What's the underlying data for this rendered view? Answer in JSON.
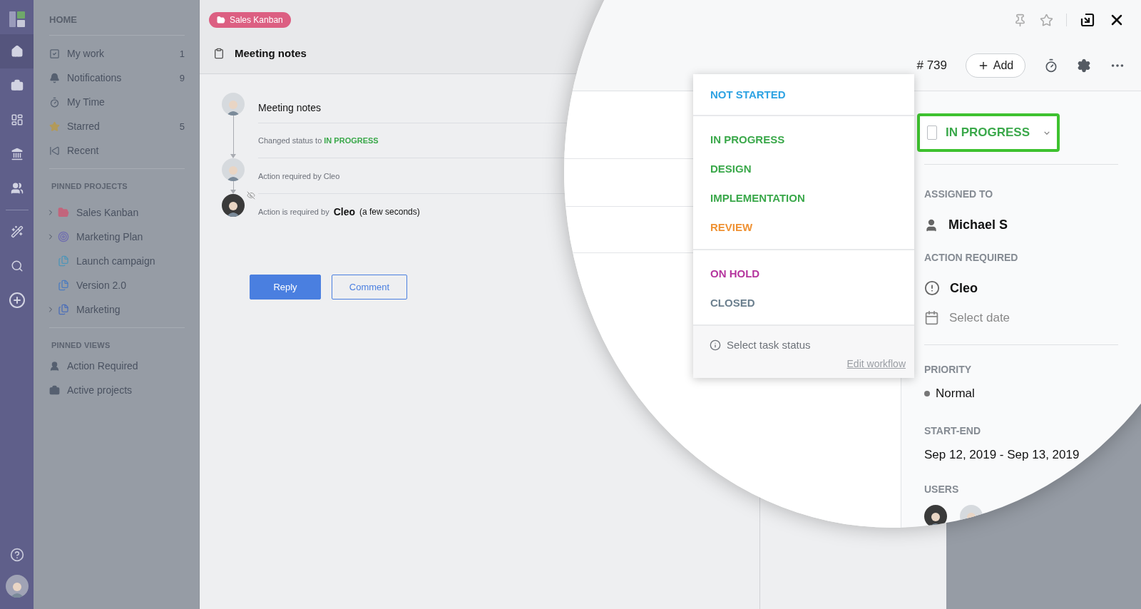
{
  "rail": {
    "items": [
      {
        "selected": true
      },
      {
        "selected": false
      },
      {
        "selected": false
      },
      {
        "selected": false
      },
      {
        "selected": false
      },
      {
        "selected": false
      },
      {
        "selected": false
      },
      {
        "selected": false
      }
    ]
  },
  "nav": {
    "title": "HOME",
    "items": [
      {
        "label": "My work",
        "count": "1"
      },
      {
        "label": "Notifications",
        "count": "9"
      },
      {
        "label": "My Time"
      },
      {
        "label": "Starred",
        "count": "5"
      },
      {
        "label": "Recent"
      }
    ],
    "pinned_projects": {
      "title": "PINNED PROJECTS",
      "items": [
        {
          "label": "Sales Kanban",
          "expandable": true,
          "color": "#c2657c"
        },
        {
          "label": "Marketing Plan",
          "expandable": true,
          "color": "#6f6db0"
        },
        {
          "label": "Launch campaign",
          "expandable": false,
          "color": "#4f95b8"
        },
        {
          "label": "Version 2.0",
          "expandable": false,
          "color": "#4d7cbf"
        },
        {
          "label": "Marketing",
          "expandable": true,
          "color": "#4d6fb8"
        }
      ]
    },
    "pinned_views": {
      "title": "PINNED VIEWS",
      "items": [
        {
          "label": "Action Required"
        },
        {
          "label": "Active projects"
        }
      ]
    }
  },
  "task": {
    "project_chip": "Sales Kanban",
    "title": "Meeting notes",
    "timeline": [
      {
        "kind": "comment",
        "text": "Meeting notes"
      },
      {
        "kind": "status",
        "text": "Changed status to",
        "status": "IN PROGRESS"
      },
      {
        "kind": "action",
        "text": "Action required by Cleo"
      },
      {
        "kind": "action_detail",
        "text": "Action is required by",
        "name": "Cleo",
        "time": "(a few seconds)"
      }
    ],
    "buttons": [
      "Reply",
      "Comment"
    ]
  },
  "lens": {
    "task_number": "# 739",
    "add_button": "Add",
    "status": {
      "label": "IN PROGRESS",
      "checked": false
    },
    "status_menu": {
      "groups": [
        [
          {
            "label": "NOT STARTED",
            "color": "#2ea3e3"
          }
        ],
        [
          {
            "label": "IN PROGRESS",
            "color": "#3aa84a"
          },
          {
            "label": "DESIGN",
            "color": "#3aa84a"
          },
          {
            "label": "IMPLEMENTATION",
            "color": "#3aa84a"
          },
          {
            "label": "REVIEW",
            "color": "#ef9234"
          }
        ],
        [
          {
            "label": "ON HOLD",
            "color": "#b5359e"
          },
          {
            "label": "CLOSED",
            "color": "#6b7f8e"
          }
        ]
      ],
      "hint": "Select task status",
      "link": "Edit workflow"
    },
    "assigned_to": {
      "label": "ASSIGNED TO",
      "value": "Michael S"
    },
    "action_required": {
      "label": "ACTION REQUIRED",
      "value": "Cleo",
      "date_placeholder": "Select date"
    },
    "priority": {
      "label": "PRIORITY",
      "value": "Normal"
    },
    "start_end": {
      "label": "START-END",
      "value": "Sep 12, 2019 - Sep 13, 2019"
    },
    "users": {
      "label": "USERS"
    }
  }
}
